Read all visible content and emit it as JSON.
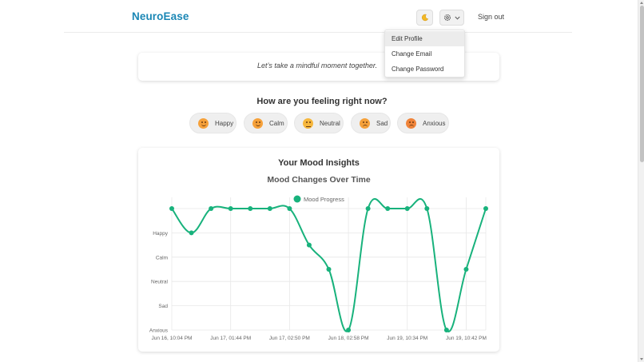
{
  "header": {
    "brand": "NeuroEase",
    "moon_icon": "moon-icon",
    "gear_icon": "gear-icon",
    "sign_out": "Sign out",
    "brand_color": "#1b87b5"
  },
  "settings_menu": {
    "items": [
      "Edit Profile",
      "Change Email",
      "Change Password"
    ],
    "highlighted": "Edit Profile"
  },
  "message": "Let’s take a mindful moment together.",
  "mood_picker": {
    "question": "How are you feeling right now?",
    "moods": [
      {
        "label": "Happy",
        "color": "#f6a13a"
      },
      {
        "label": "Calm",
        "color": "#f6a13a"
      },
      {
        "label": "Neutral",
        "color": "#f6b73d"
      },
      {
        "label": "Sad",
        "color": "#f6a13a"
      },
      {
        "label": "Anxious",
        "color": "#f0843a"
      }
    ]
  },
  "insights_title": "Your Mood Insights",
  "chart_data": {
    "type": "line",
    "title": "Mood Changes Over Time",
    "legend": "top",
    "grid": true,
    "series": [
      {
        "name": "Mood Progress",
        "color": "#18b27c",
        "values": [
          5,
          4,
          5,
          5,
          5,
          5,
          5,
          3.5,
          2.5,
          0,
          5,
          5,
          5,
          5,
          0,
          2.5,
          5
        ]
      }
    ],
    "y_categories": [
      "Anxious",
      "Sad",
      "Neutral",
      "Calm",
      "Happy"
    ],
    "ylim": [
      0,
      5
    ],
    "x_tick_labels": [
      "Jun 16, 10:04 PM",
      "Jun 17, 01:44 PM",
      "Jun 17, 02:50 PM",
      "Jun 18, 02:58 PM",
      "Jun 19, 10:34 PM",
      "Jun 19, 10:42 PM"
    ],
    "x_tick_indices": [
      0,
      3,
      6,
      9,
      12,
      15
    ]
  }
}
